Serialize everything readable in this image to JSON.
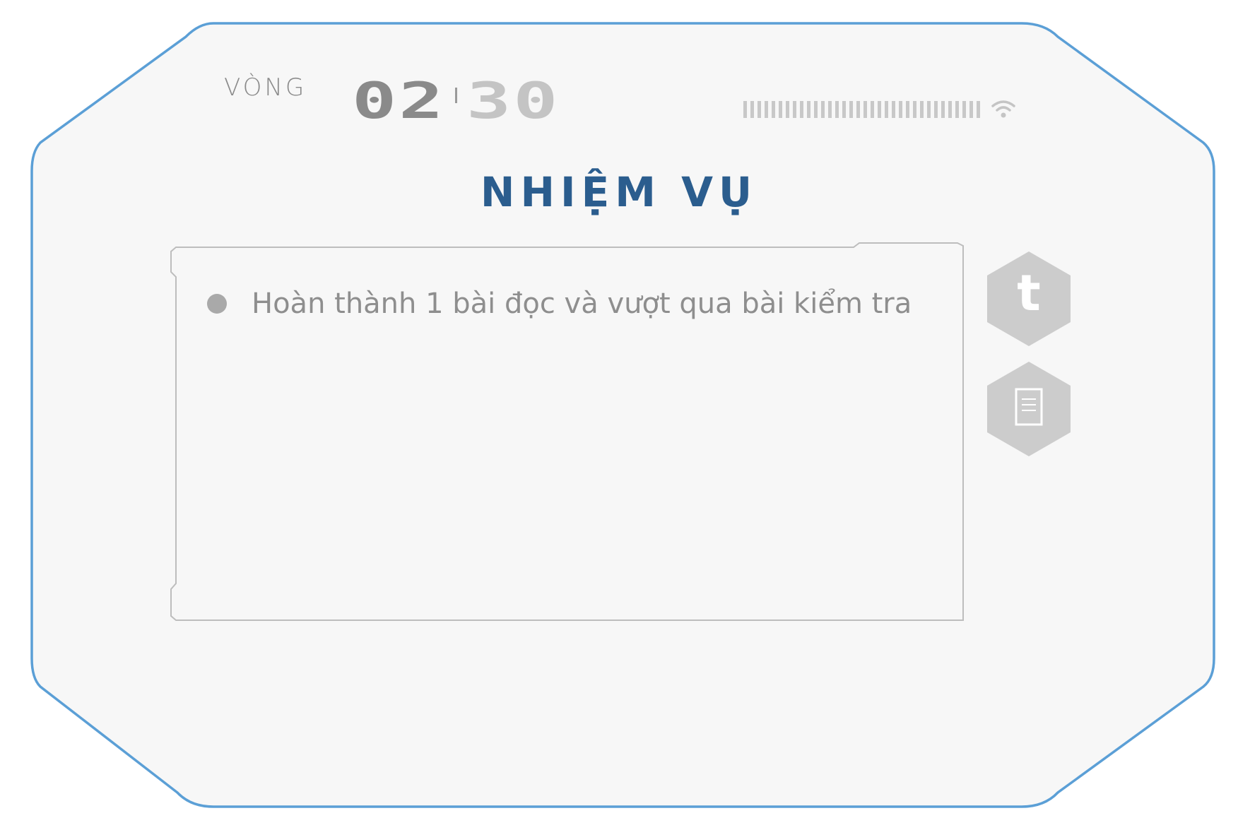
{
  "header": {
    "round_label": "VÒNG",
    "round_current": "02",
    "round_total": "30"
  },
  "title": "NHIỆM VỤ",
  "tasks": [
    {
      "text": "Hoàn thành 1 bài đọc và vượt qua bài kiểm tra"
    }
  ],
  "side_buttons": {
    "translate_letter": "t",
    "translate_icon": "letter-t-icon",
    "document_icon": "document-icon"
  },
  "colors": {
    "frame_border": "#5b9fd6",
    "title": "#2b5d8e",
    "muted_text": "#8e8e8e",
    "hex_fill": "#cccccc",
    "panel_bg": "#f7f7f7"
  }
}
